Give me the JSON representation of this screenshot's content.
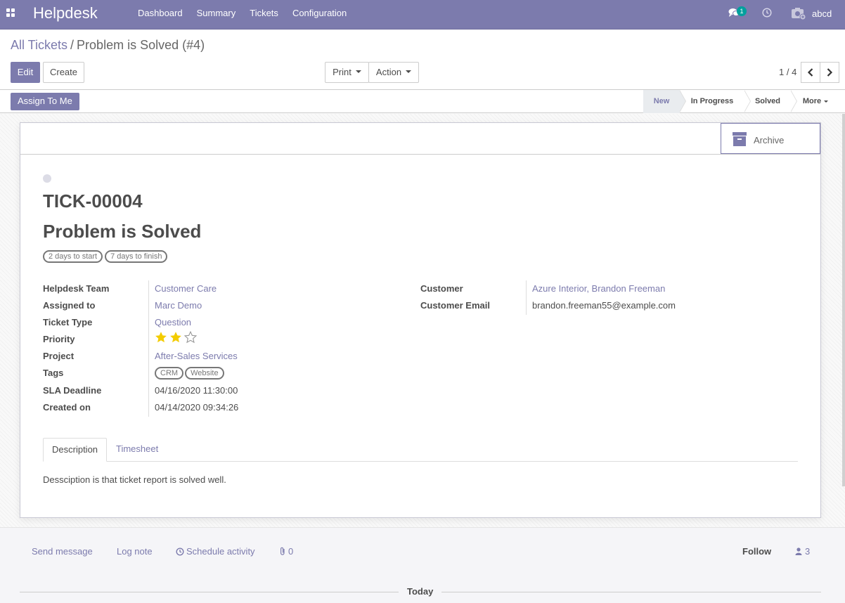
{
  "navbar": {
    "brand": "Helpdesk",
    "menu": [
      "Dashboard",
      "Summary",
      "Tickets",
      "Configuration"
    ],
    "chat_badge": "1",
    "user_name": "abcd"
  },
  "breadcrumb": {
    "parent": "All Tickets",
    "separator": "/",
    "current": "Problem is Solved (#4)"
  },
  "toolbar": {
    "edit_label": "Edit",
    "create_label": "Create",
    "print_label": "Print",
    "action_label": "Action",
    "pager_text": "1 / 4"
  },
  "statusbar": {
    "assign_label": "Assign To Me",
    "stages": [
      "New",
      "In Progress",
      "Solved"
    ],
    "active_stage": "New",
    "more_label": "More"
  },
  "sheet": {
    "archive_label": "Archive",
    "reference": "TICK-00004",
    "title": "Problem is Solved",
    "sla_pills": [
      "2 days to start",
      "7 days to finish"
    ]
  },
  "fields_left": {
    "team_label": "Helpdesk Team",
    "team_value": "Customer Care",
    "assigned_label": "Assigned to",
    "assigned_value": "Marc Demo",
    "type_label": "Ticket Type",
    "type_value": "Question",
    "priority_label": "Priority",
    "priority_stars": 2,
    "priority_max": 3,
    "project_label": "Project",
    "project_value": "After-Sales Services",
    "tags_label": "Tags",
    "tags": [
      "CRM",
      "Website"
    ],
    "sla_label": "SLA Deadline",
    "sla_value": "04/16/2020 11:30:00",
    "created_label": "Created on",
    "created_value": "04/14/2020 09:34:26"
  },
  "fields_right": {
    "customer_label": "Customer",
    "customer_value": "Azure Interior, Brandon Freeman",
    "email_label": "Customer Email",
    "email_value": "brandon.freeman55@example.com"
  },
  "tabs": {
    "description": "Description",
    "timesheet": "Timesheet",
    "description_text": "Dessciption is that ticket report is solved well."
  },
  "chatter": {
    "send_message": "Send message",
    "log_note": "Log note",
    "schedule_activity": "Schedule activity",
    "attachments": "0",
    "follow": "Follow",
    "followers": "3",
    "today": "Today"
  },
  "colors": {
    "brand": "#7c7bad",
    "star": "#f3cc00",
    "badge": "#00a09d"
  }
}
